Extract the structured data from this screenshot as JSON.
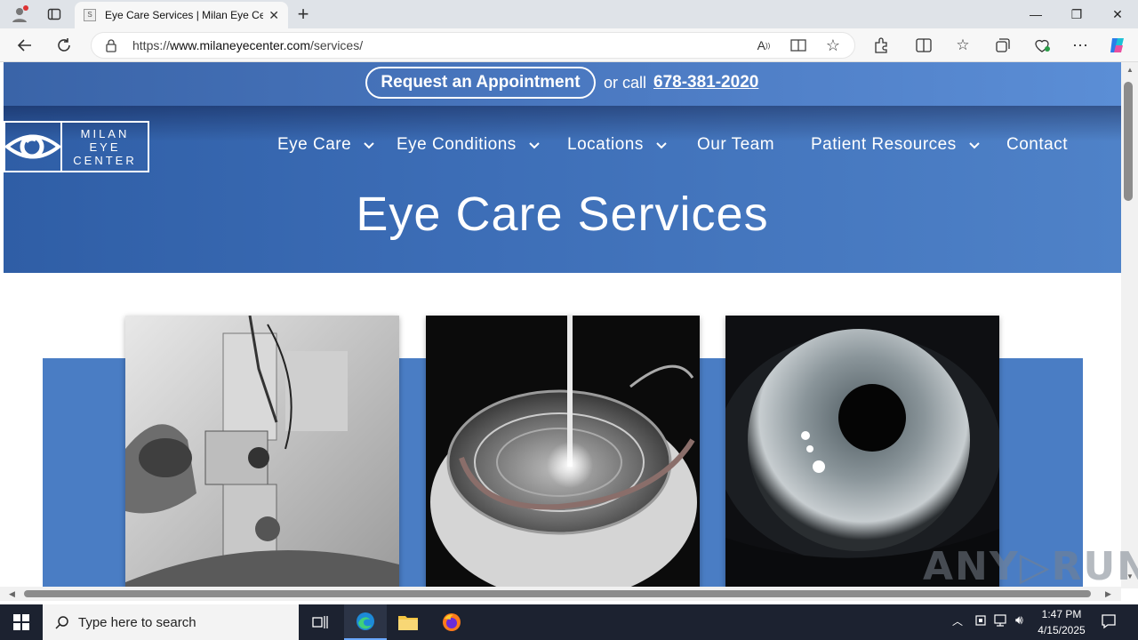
{
  "browser": {
    "tab_title": "Eye Care Services | Milan Eye Cen",
    "new_tab": "+",
    "url_prefix": "https://",
    "url_host": "www.milaneyecenter.com",
    "url_path": "/services/",
    "minimize": "—",
    "restore": "❐",
    "close": "✕"
  },
  "site": {
    "appointment_label": "Request an Appointment",
    "or_call": "or call",
    "phone": "678-381-2020",
    "logo_lines": [
      "MILAN",
      "EYE",
      "CENTER"
    ],
    "nav": [
      {
        "label": "Eye Care",
        "dropdown": true
      },
      {
        "label": "Eye Conditions",
        "dropdown": true
      },
      {
        "label": "Locations",
        "dropdown": true
      },
      {
        "label": "Our Team",
        "dropdown": false
      },
      {
        "label": "Patient Resources",
        "dropdown": true
      },
      {
        "label": "Contact",
        "dropdown": false
      }
    ],
    "page_title": "Eye Care Services"
  },
  "watermark": "ANY▷RUN",
  "taskbar": {
    "search_placeholder": "Type here to search",
    "time": "1:47 PM",
    "date": "4/15/2025"
  },
  "colors": {
    "brand_blue": "#3c6db6",
    "band_blue": "#4a7dc4",
    "taskbar": "#1c2230"
  }
}
